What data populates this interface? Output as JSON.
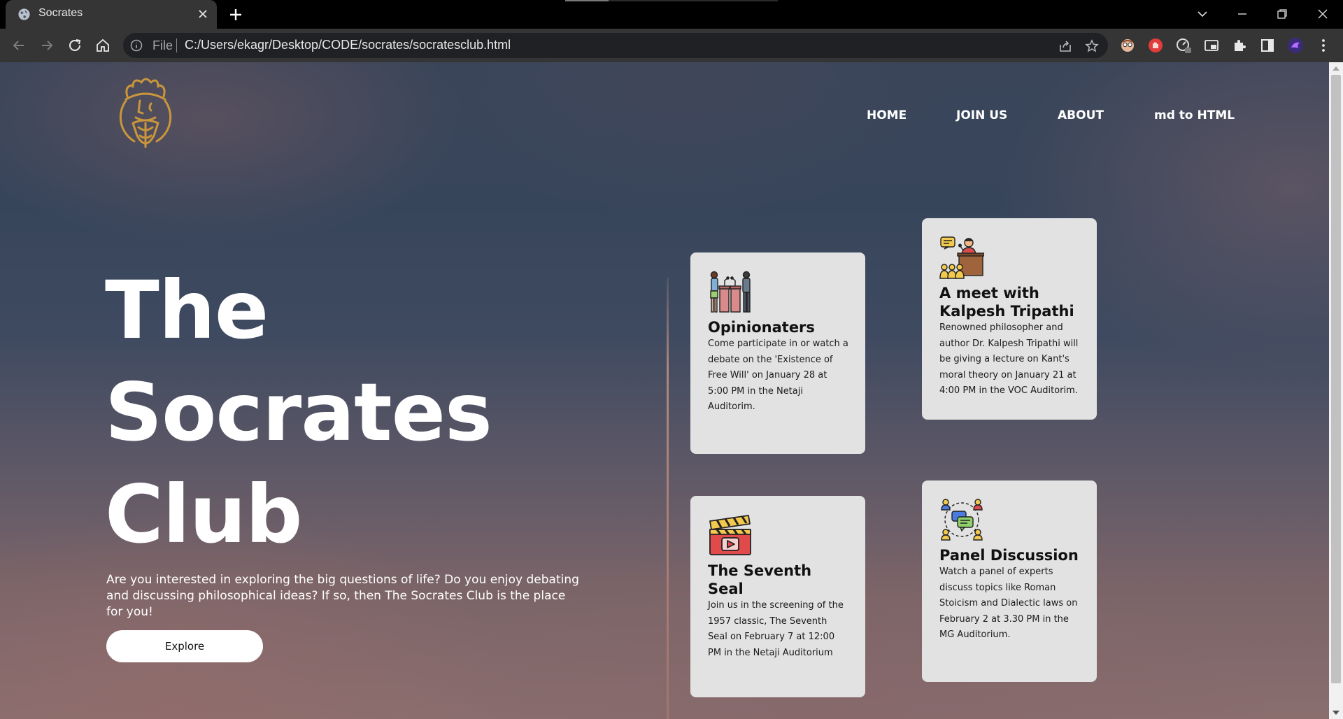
{
  "browser": {
    "tab_title": "Socrates",
    "omnibox_scheme": "File",
    "url": "C:/Users/ekagr/Desktop/CODE/socrates/socratesclub.html"
  },
  "nav": {
    "items": [
      "HOME",
      "JOIN US",
      "ABOUT",
      "md to HTML"
    ]
  },
  "hero": {
    "title_lines": [
      "The",
      "Socrates",
      "Club"
    ],
    "description": "Are you interested in exploring the big questions of life? Do you enjoy debating and discussing philosophical ideas? If so, then The Socrates Club is the place for you!",
    "cta_label": "Explore"
  },
  "cards": [
    {
      "icon": "debate-podium-icon",
      "title": "Opinionaters",
      "text": "Come participate in or watch a debate on the 'Existence of Free Will' on January 28 at 5:00 PM in the Netaji Auditorim."
    },
    {
      "icon": "lecture-speaker-icon",
      "title": "A meet with Kalpesh Tripathi",
      "text": "Renowned philosopher and author Dr. Kalpesh Tripathi will be giving a lecture on Kant's moral theory on January 21 at 4:00 PM in the VOC Auditorim."
    },
    {
      "icon": "film-clapperboard-icon",
      "title": "The Seventh Seal",
      "text": "Join us in the screening of the 1957 classic, The Seventh Seal on February 7 at 12:00 PM in the Netaji Auditorium"
    },
    {
      "icon": "group-discussion-icon",
      "title": "Panel Discussion",
      "text": "Watch a panel of experts discuss topics like Roman Stoicism and Dialectic laws on February 2 at 3.30 PM in the MG Auditorium."
    }
  ],
  "colors": {
    "logo_gold": "#c9963b",
    "card_bg": "#e2e2e2",
    "chrome_dark": "#000000",
    "chrome_toolbar": "#353535"
  }
}
